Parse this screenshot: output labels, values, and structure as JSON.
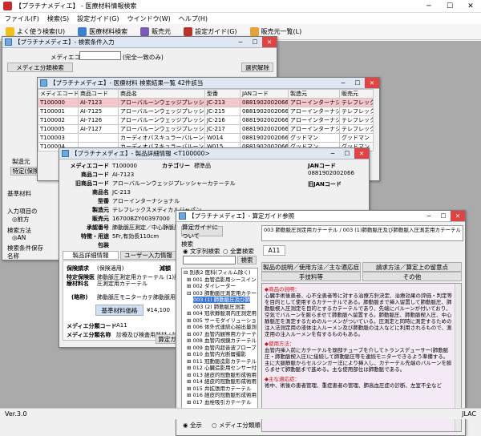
{
  "app": {
    "title": "【プラチナメディエ】 - 医療材料情報検索",
    "menus": [
      "ファイル(F)",
      "検索(S)",
      "ウインドウ(W)",
      "ヘルプ(H)"
    ],
    "menu_hidden": [
      "プラチナ",
      "設定ガイド(G)"
    ],
    "toolbar": [
      "よく使う検索(U)",
      "医療材料検索",
      "販売元",
      "設定ガイド(G)",
      "販売元一覧(L)"
    ],
    "status_left": "Ver.3.0",
    "status_right": "JLAC"
  },
  "search_win": {
    "title": "【プラチナメディエ】- 検索条件入力",
    "code_label": "メディエコード",
    "code_hint": "(完全一致のみ)",
    "class_btn": "メディエ分類検索",
    "clear_btn": "選択解除",
    "left_labels": [
      "製造元",
      "特定(保険",
      "基準材料",
      "入力項目の",
      "前方",
      "検索方法",
      "AN",
      "検索条件保存",
      "名称"
    ],
    "radio_mark": "◎"
  },
  "result_win": {
    "title": "【プラチナメディエ】- 医療材料 検索結果一覧 42件該当",
    "headers": [
      "メディエコード",
      "商品コード",
      "商品名",
      "型番",
      "JANコード",
      "製造元",
      "販売元"
    ],
    "rows": [
      [
        "T100000",
        "AI-7123",
        "アローバルーンウェッジプレッシャーカテーテル",
        "JC-213",
        "0881902002066",
        "アローインターナショナル",
        "テレフレックス"
      ],
      [
        "T100001",
        "AI-7125",
        "アローバルーンウェッジプレッシャーカテーテル",
        "JC-215",
        "0881902002066",
        "アローインターナショナル",
        "テレフレックス"
      ],
      [
        "T100002",
        "AI-7126",
        "アローバルーンウェッジプレッシャーカテーテル",
        "JC-216",
        "0881902002066",
        "アローインターナショナル",
        "テレフレックス"
      ],
      [
        "T100005",
        "AI-7127",
        "アローバルーンウェッジプレッシャーカテーテル",
        "JC-217",
        "0881902002066",
        "アローインターナショナル",
        "テレフレックス"
      ],
      [
        "T100003",
        "",
        "カーディオバスキュラーバルーン",
        "W014",
        "0881902002066",
        "グッドマン",
        "グッドマン"
      ],
      [
        "T100004",
        "",
        "カーディオバスキュラーバルーン",
        "W015",
        "0881902002066",
        "グッドマン",
        "グッドマン"
      ]
    ]
  },
  "detail_win": {
    "title": "【プラチナメディエ】- 製品詳細情報 <T100000>",
    "fields": [
      {
        "label": "メディエコード",
        "value": "T100000"
      },
      {
        "label": "商品コード",
        "value": "AI-7123"
      },
      {
        "label": "旧商品コード",
        "value": ""
      },
      {
        "label": "商品名",
        "value": "アローバルーンウェッジプレッシャーカテーテル"
      },
      {
        "label": "型番",
        "value": "JC-213"
      },
      {
        "label": "製造元",
        "value": "アローインターナショナル"
      },
      {
        "label": "販売元",
        "value": "テレフレックスメディカルジャパン"
      },
      {
        "label": "承認番号",
        "value": "16700BZY00397000"
      },
      {
        "label": "特徴・用途",
        "value": "肺動脈圧測定／中心静脈圧測定用"
      },
      {
        "label": "包装",
        "value": "5Fr,有効長110cm"
      }
    ],
    "category_label": "カテゴリー",
    "category_value": "標準品",
    "jan_label": "JANコード",
    "jan_value": "0881902002066",
    "oldjan_label": "旧JANコード",
    "tab1": "製品詳細情報",
    "tab2": "ユーザー入力情報",
    "insurance_label": "保険請求",
    "insurance_value": "(保険適用)",
    "reduce_label": "減額",
    "spec_label": "特定保険医療材料名",
    "spec_value": "肺動脈圧測定用カテーテル (1)肺動脈圧及び肺動脈入圧測定用カテーテル",
    "short_label": "(略称)",
    "short_value": "肺動脈圧モニターカテ肺動脈用",
    "price_btn": "基準材料価格",
    "price_value": "¥14,100",
    "mediecat_label": "メディエ分類コード",
    "mediecat_value": "A11",
    "mediename_label": "メディエ分類名称",
    "mediename_value": "診療及び検査用器材 / 診療用",
    "guide_btn": "算定ガイド"
  },
  "guide_win": {
    "title": "【プラチナメディエ】- 算定ガイド参照",
    "about_btn": "算定ガイドについて",
    "search_label": "検索",
    "radio1": "文字列検索",
    "radio2": "全要検索",
    "search_btn": "検索",
    "code_box": "A11",
    "header_text": "003 肺動脈圧測定用カテーテル / 003 (1)肺動脈圧及び肺動脈入圧測定用カテーテル",
    "tabs": [
      "製品の説明／使用方法／主な適応症",
      "請求方法／算定上の留意点",
      "手技料等",
      "その他"
    ],
    "tree": [
      "別表2 医科(フィルム除く)",
      "001 血管造影用シースイントロ",
      "002 ダイレーター",
      "003 肺動脈圧測定用カテーテル",
      "003 (1) 肺動脈圧及び肺",
      "003 (2) 肺動脈圧測定",
      "004 冠状静脈洞内圧測定用カ",
      "005 サーモダイリューション用",
      "006 体外式連続心拍出量測",
      "007 血管内観察用カテーテル",
      "008 血管内視鏡カテーテル",
      "009 血管内超音波プローブ",
      "010 血管内光断層撮影",
      "011 冠動脈造影カテーテル",
      "012 心臓造影用センサー付き",
      "013 経皮的冠動脈形成術用",
      "014 経皮的冠動脈形成術用",
      "015 弁拡張用カテーテル",
      "016 経皮的冠動脈形成術用",
      "017 血栓吸引カテーテル"
    ],
    "bottom_radio1": "全示",
    "bottom_radio2": "メディエ分類順",
    "s1_title": "◆商品の説明：",
    "s1_text": "心臓手術後患者、心不全患者等に対する治療方針決定、治療効果の評価・判定等を目的として使用するカテーテルである。肺動脈まで挿入留置して肺動脈圧、肺動脈楔入圧測定を目的とするカテーテルであり、先端にバルーンが付いており、空気でバルーンを膨らませて肺動脈へ留置する。肺動脈圧、肺動脈楔入圧、中心静脈圧を測定するためのルーメンがついている。圧測定と同時に測定するための注入法測定用の液体注入ルーメン及び肺動脈の注入などに利用されるもので、測定用の注入ルーメンを有するものもある。",
    "s2_title": "◆使用方法：",
    "s2_text": "血管内挿入前にカテーテルを頭部チューブを介してトランスデューサー(肺動脈圧・肺動脈楔入圧)に接続して肺動脈圧等を連続モニターできるよう準備する。主に大腿静脈からセルジンガー法により挿入し、カテーテル先端のバルーンを膨らませて肺動脈まで進める。主な使用部位は肺動脈である。",
    "s3_title": "◆主な適応症：",
    "s3_text": "術中、術後の患者管理、重症患者の管理、肺高血圧症の診断、左室不全など"
  }
}
